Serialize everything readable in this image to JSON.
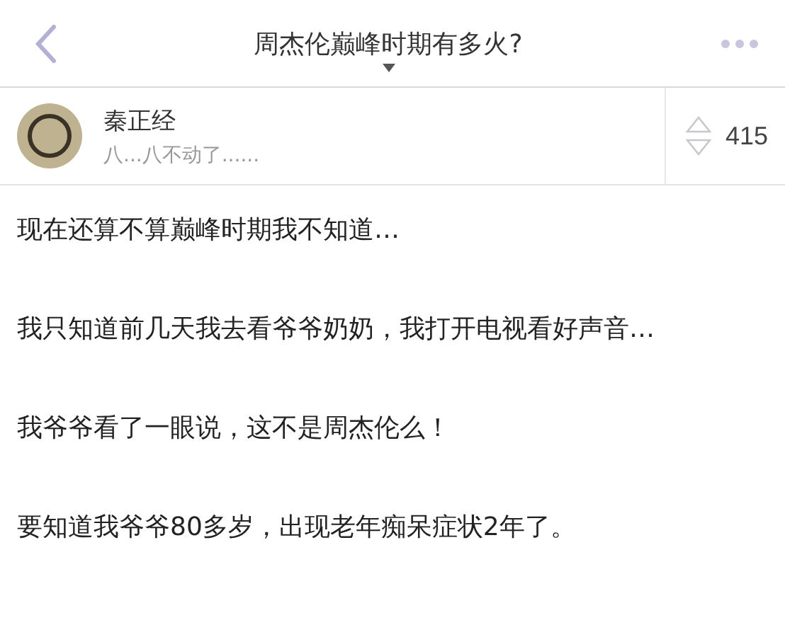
{
  "nav": {
    "title": "周杰伦巅峰时期有多火?"
  },
  "author": {
    "name": "秦正经",
    "bio": "八...八不动了......",
    "votes": "415"
  },
  "paragraphs": [
    "现在还算不算巅峰时期我不知道…",
    "我只知道前几天我去看爷爷奶奶，我打开电视看好声音…",
    "我爷爷看了一眼说，这不是周杰伦么！",
    "要知道我爷爷80多岁，出现老年痴呆症状2年了。"
  ]
}
